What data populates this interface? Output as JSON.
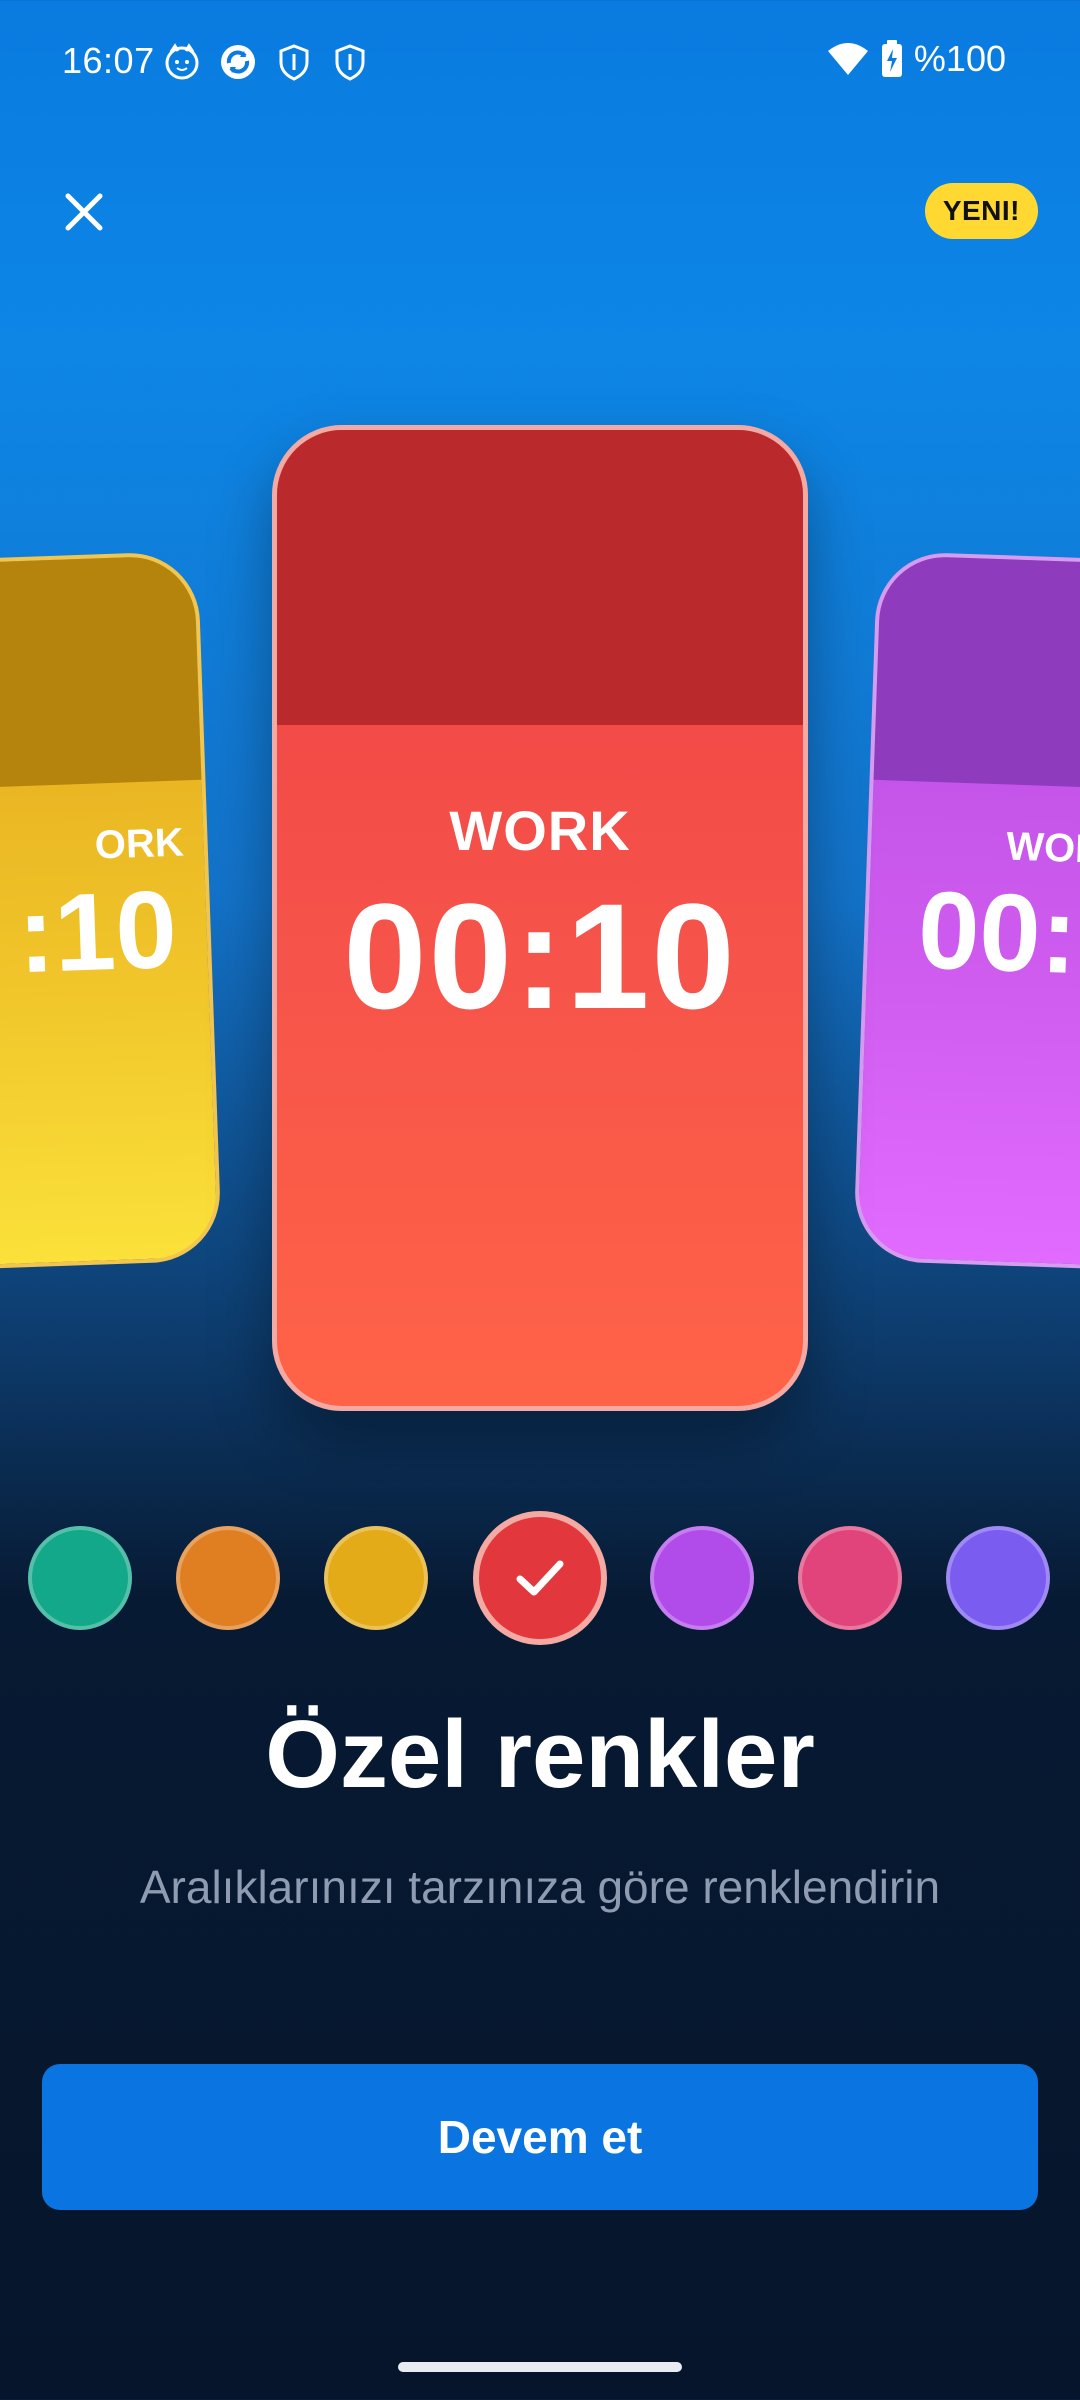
{
  "status_bar": {
    "time": "16:07",
    "battery": "%100",
    "left_icons": [
      "cat-face-icon",
      "sync-app-icon",
      "shield-icon",
      "shield-icon"
    ],
    "right_icons": [
      "wifi-icon",
      "battery-charging-icon"
    ]
  },
  "header": {
    "close_icon": "close-icon",
    "badge": "YENI!"
  },
  "cards": {
    "left": {
      "label": "ORK",
      "time": ":10",
      "color": "#e3a61b"
    },
    "center": {
      "label": "WORK",
      "time": "00:10",
      "color": "#ef3f42"
    },
    "right": {
      "label": "WOR",
      "time": "00:",
      "color": "#c152e8"
    }
  },
  "swatches": [
    {
      "color": "#14a88a",
      "selected": false
    },
    {
      "color": "#e07f22",
      "selected": false
    },
    {
      "color": "#e4ab19",
      "selected": false
    },
    {
      "color": "#e1373d",
      "selected": true
    },
    {
      "color": "#b14ceb",
      "selected": false
    },
    {
      "color": "#e0447a",
      "selected": false
    },
    {
      "color": "#7a5cf0",
      "selected": false
    }
  ],
  "content": {
    "title": "Özel renkler",
    "subtitle": "Aralıklarınızı tarzınıza göre renklendirin"
  },
  "button": {
    "label": "Devem et"
  }
}
